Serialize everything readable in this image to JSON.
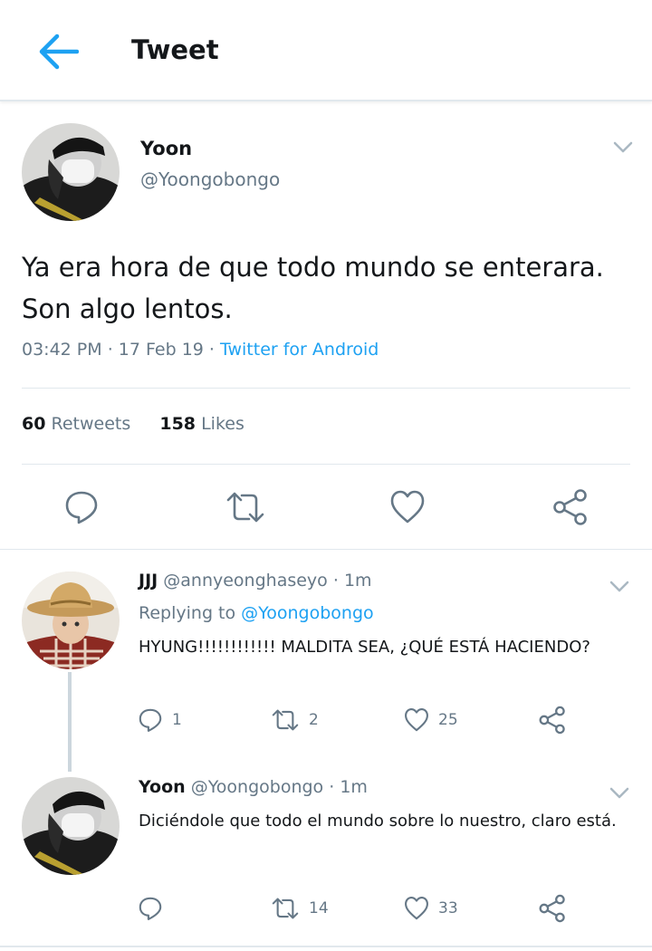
{
  "header": {
    "title": "Tweet"
  },
  "tweet": {
    "name": "Yoon",
    "handle": "@Yoongobongo",
    "text": "Ya era hora de que todo mundo se enterara. Son algo lentos.",
    "time": "03:42 PM",
    "date": "17 Feb 19",
    "source": "Twitter for Android",
    "retweets": "60",
    "retweets_label": "Retweets",
    "likes": "158",
    "likes_label": "Likes"
  },
  "replies": [
    {
      "name": "JJJ",
      "handle": "@annyeonghaseyo",
      "time": "1m",
      "replying_label": "Replying to",
      "replying_to": "@Yoongobongo",
      "text": "HYUNG!!!!!!!!!!!! MALDITA SEA, ¿QUÉ ESTÁ HACIENDO?",
      "reply_count": "1",
      "retweet_count": "2",
      "like_count": "25"
    },
    {
      "name": "Yoon",
      "handle": "@Yoongobongo",
      "time": "1m",
      "text": "Diciéndole que todo el mundo sobre lo nuestro, claro está.",
      "reply_count": "",
      "retweet_count": "14",
      "like_count": "33"
    }
  ],
  "colors": {
    "accent": "#1da1f2",
    "muted": "#657786",
    "text": "#14171a",
    "divider": "#e1e8ed"
  },
  "icons": [
    "back-arrow-icon",
    "chevron-down-icon",
    "reply-icon",
    "retweet-icon",
    "like-icon",
    "share-icon"
  ]
}
